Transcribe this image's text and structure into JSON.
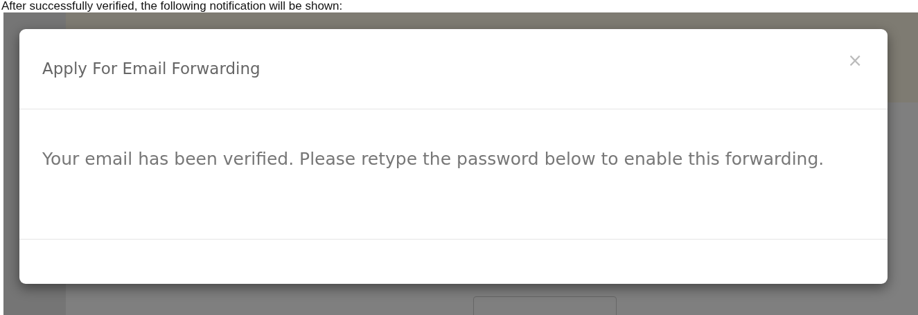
{
  "caption": "After successfully verified, the following notification will be shown:",
  "modal": {
    "title": "Apply For Email Forwarding",
    "close": "×",
    "message": "Your email has been verified. Please retype the password below to enable this forwarding."
  }
}
